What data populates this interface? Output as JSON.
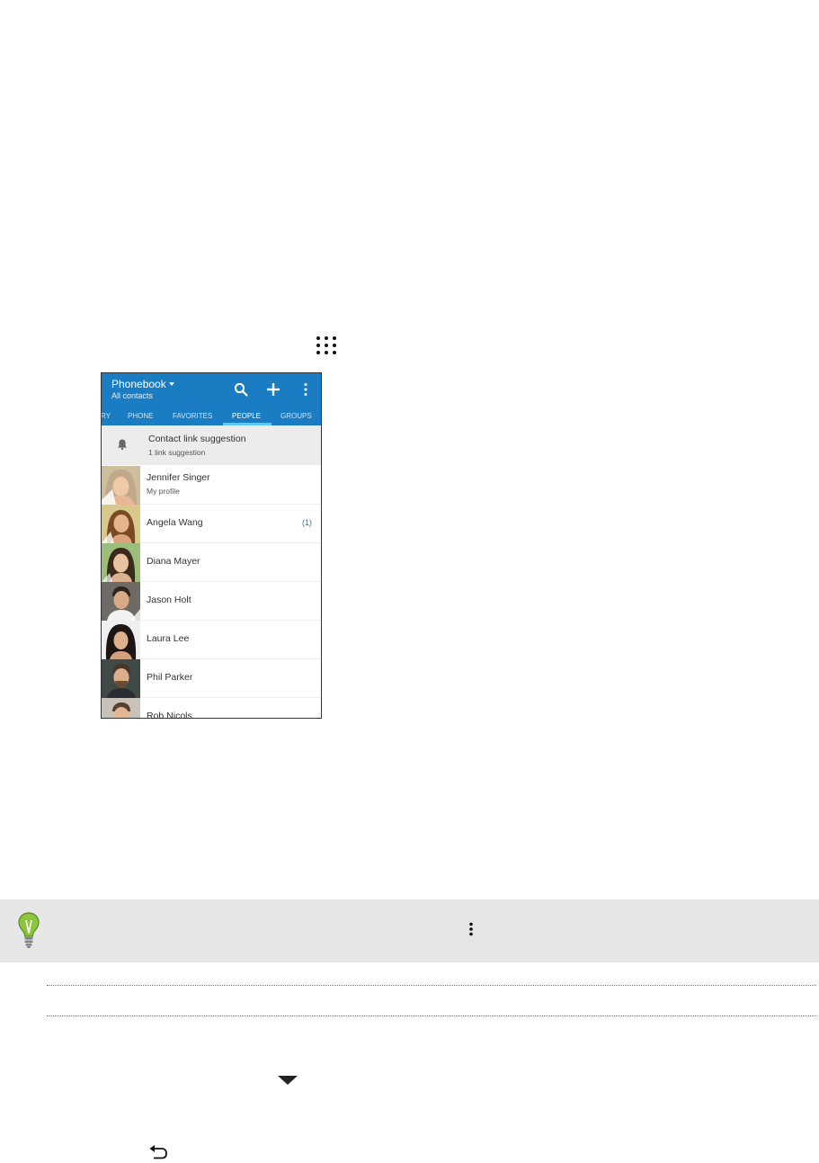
{
  "phone": {
    "app_title": "Phonebook",
    "app_subtitle": "All contacts",
    "tabs": [
      {
        "label": "RY",
        "active": false
      },
      {
        "label": "PHONE",
        "active": false
      },
      {
        "label": "FAVORITES",
        "active": false
      },
      {
        "label": "PEOPLE",
        "active": true
      },
      {
        "label": "GROUPS",
        "active": false
      }
    ],
    "suggestion": {
      "title": "Contact link suggestion",
      "subtitle": "1 link suggestion"
    },
    "contacts": [
      {
        "name": "Jennifer Singer",
        "subtitle": "My profile",
        "badge": ""
      },
      {
        "name": "Angela Wang",
        "subtitle": "",
        "badge": "(1)"
      },
      {
        "name": "Diana Mayer",
        "subtitle": "",
        "badge": ""
      },
      {
        "name": "Jason Holt",
        "subtitle": "",
        "badge": ""
      },
      {
        "name": "Laura Lee",
        "subtitle": "",
        "badge": ""
      },
      {
        "name": "Phil Parker",
        "subtitle": "",
        "badge": ""
      },
      {
        "name": "Rob Nicols",
        "subtitle": "",
        "badge": ""
      }
    ]
  },
  "colors": {
    "app_bar": "#1a7dc4",
    "tab_indicator": "#5cc6f5",
    "tip_background": "#e6e6e6",
    "bulb": "#8bc43f"
  },
  "icons": {
    "apps": "grid-icon",
    "menu": "more-vertical-icon",
    "expand": "caret-down-icon",
    "back": "back-arrow-icon",
    "tip": "lightbulb-icon"
  }
}
